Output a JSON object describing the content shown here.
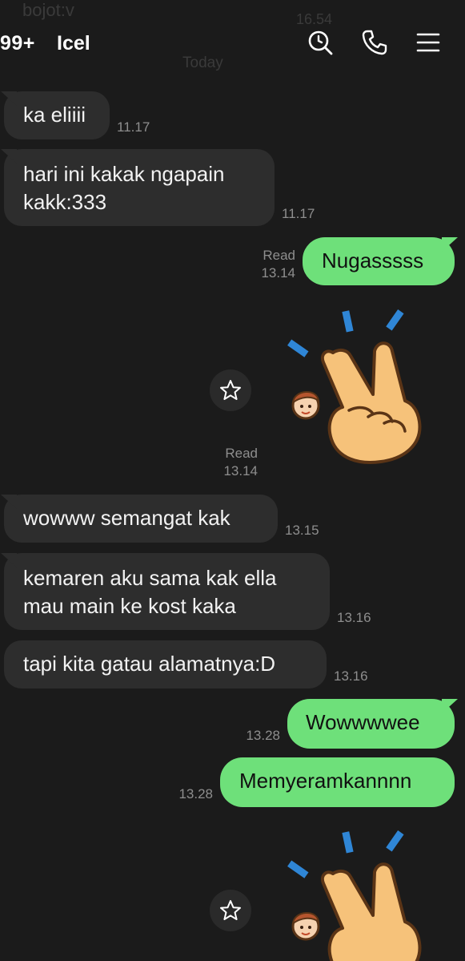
{
  "background_preview": {
    "sender": "bojot:v",
    "time": "16.54",
    "date": "Today"
  },
  "header": {
    "unread_count": "99+",
    "title": "Icel",
    "icons": [
      "search-icon",
      "phone-icon",
      "menu-icon"
    ]
  },
  "messages": [
    {
      "text": "ka eliiii",
      "time": "11.17",
      "direction": "in"
    },
    {
      "text": "hari ini kakak ngapain kakk:333",
      "time": "11.17",
      "direction": "in"
    },
    {
      "text": "Nugasssss",
      "status": "Read",
      "time": "13.14",
      "direction": "out"
    },
    {
      "sticker": "peace-hand-sticker",
      "status": "Read",
      "time": "13.14",
      "direction": "out"
    },
    {
      "text": "wowww semangat kak",
      "time": "13.15",
      "direction": "in"
    },
    {
      "text": "kemaren aku sama kak ella mau main ke kost kaka",
      "time": "13.16",
      "direction": "in"
    },
    {
      "text": "tapi kita gatau alamatnya:D",
      "time": "13.16",
      "direction": "in"
    },
    {
      "text": "Wowwwwee",
      "time": "13.28",
      "direction": "out"
    },
    {
      "text": "Memyeramkannnn",
      "time": "13.28",
      "direction": "out"
    },
    {
      "sticker": "peace-hand-sticker",
      "direction": "out"
    }
  ],
  "colors": {
    "background": "#1b1b1b",
    "incoming_bubble": "#2d2d2d",
    "outgoing_bubble": "#6ee07a",
    "timestamp": "#8e8e8e"
  }
}
